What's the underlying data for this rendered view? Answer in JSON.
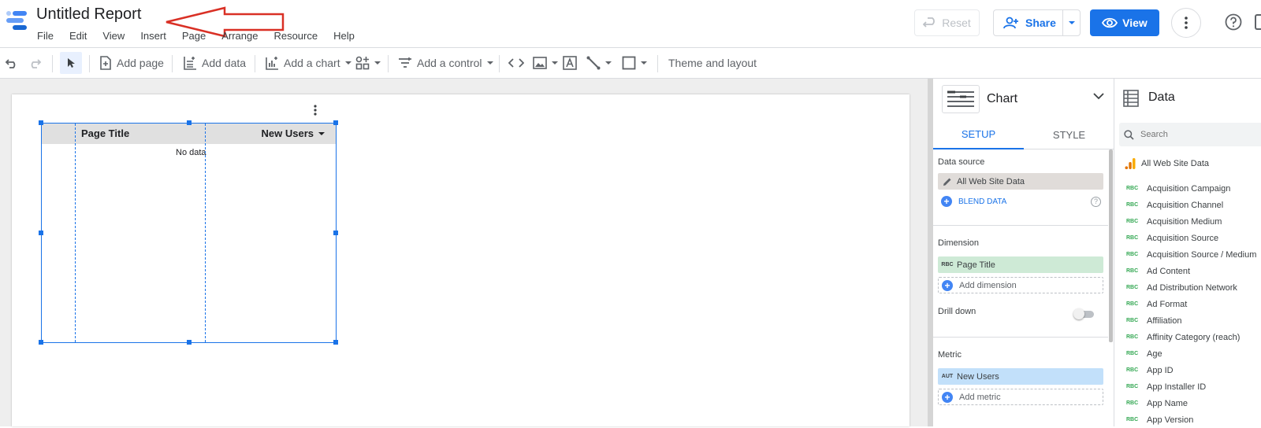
{
  "header": {
    "title": "Untitled Report",
    "menu": [
      "File",
      "Edit",
      "View",
      "Insert",
      "Page",
      "Arrange",
      "Resource",
      "Help"
    ],
    "reset_label": "Reset",
    "share_label": "Share",
    "view_label": "View"
  },
  "toolbar": {
    "add_page": "Add page",
    "add_data": "Add data",
    "add_chart": "Add a chart",
    "add_control": "Add a control",
    "theme_layout": "Theme and layout"
  },
  "canvas": {
    "table": {
      "col1": "Page Title",
      "col2": "New Users",
      "empty_text": "No data"
    }
  },
  "chart_panel": {
    "title": "Chart",
    "tabs": [
      "SETUP",
      "STYLE"
    ],
    "data_source_label": "Data source",
    "data_source_value": "All Web Site Data",
    "blend_label": "BLEND DATA",
    "dimension_label": "Dimension",
    "dimension_tag": "RBC",
    "dimension_value": "Page Title",
    "add_dimension": "Add dimension",
    "drill_down_label": "Drill down",
    "drill_down_on": false,
    "metric_label": "Metric",
    "metric_tag": "AUT",
    "metric_value": "New Users",
    "add_metric": "Add metric"
  },
  "data_panel": {
    "title": "Data",
    "search_placeholder": "Search",
    "source_name": "All Web Site Data",
    "field_type_tag": "RBC",
    "fields": [
      "Acquisition Campaign",
      "Acquisition Channel",
      "Acquisition Medium",
      "Acquisition Source",
      "Acquisition Source / Medium",
      "Ad Content",
      "Ad Distribution Network",
      "Ad Format",
      "Affiliation",
      "Affinity Category (reach)",
      "Age",
      "App ID",
      "App Installer ID",
      "App Name",
      "App Version"
    ]
  },
  "colors": {
    "accent": "#1a73e8",
    "dimension_chip": "#ceead6",
    "metric_chip": "#c2e0fa",
    "annotation_arrow": "#d93025"
  }
}
